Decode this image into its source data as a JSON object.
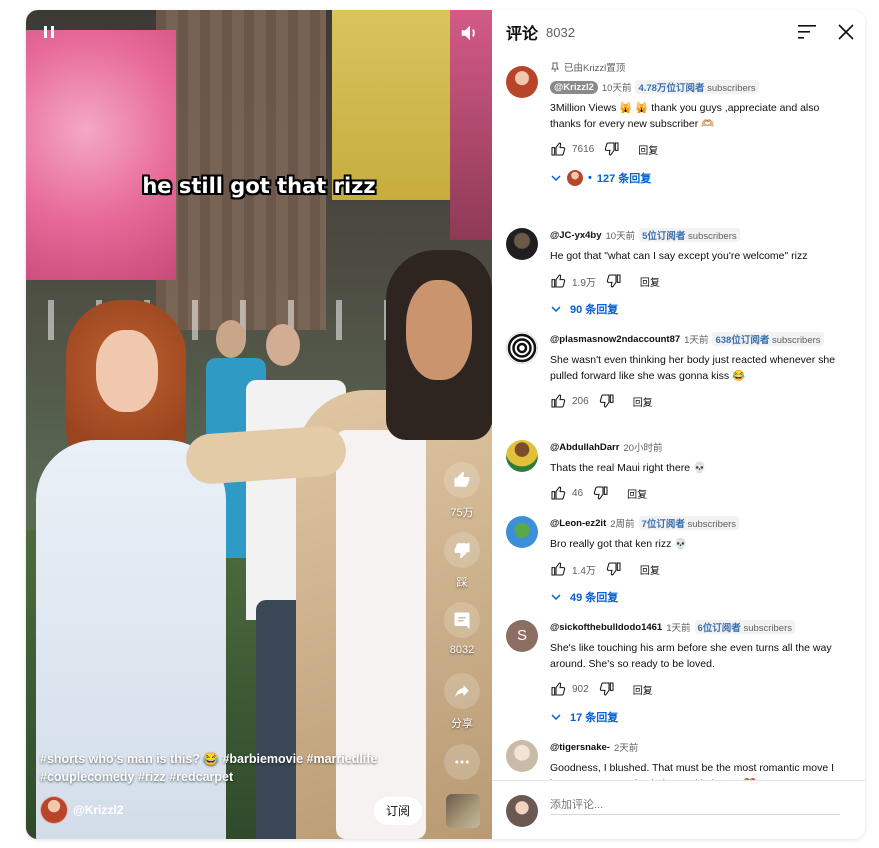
{
  "video": {
    "caption": "he still got that rizz",
    "hashtags": "#shorts who's man is this? 😂 #barbiemovie #marriedlife #couplecomedy #rizz #redcarpet",
    "channel_name": "@Krizzl2",
    "subscribe_label": "订阅",
    "like_count": "75万",
    "dislike_label": "踩",
    "comment_count": "8032",
    "share_label": "分享"
  },
  "comments_panel": {
    "title": "评论",
    "count": "8032",
    "add_placeholder": "添加评论...",
    "reply_label": "回复"
  },
  "comments": [
    {
      "pinned_label": "已由Krizzl置顶",
      "handle": "@Krizzl2",
      "owner": true,
      "time": "10天前",
      "subs_num": "4.78万位订阅者",
      "subs_suffix": "subscribers",
      "text": "3Million Views 🙀 🙀  thank you guys ,appreciate and also thanks for every new subscriber 🫶🏼",
      "likes": "7616",
      "replies": "127 条回复",
      "avatar_color": "#b8442a"
    },
    {
      "handle": "@JC-yx4by",
      "time": "10天前",
      "subs_num": "5位订阅者",
      "subs_suffix": "subscribers",
      "text": "He got that \"what can I say except you're welcome\" rizz",
      "likes": "1.9万",
      "replies": "90 条回复",
      "avatar_color": "#2b2b2b"
    },
    {
      "handle": "@plasmasnow2ndaccount87",
      "time": "1天前",
      "subs_num": "638位订阅者",
      "subs_suffix": "subscribers",
      "text": "She wasn't even thinking her body just reacted whenever she pulled forward like she was gonna kiss 😂",
      "likes": "206",
      "avatar_color": "#111111"
    },
    {
      "handle": "@AbdullahDarr",
      "time": "20小时前",
      "text": "Thats the real Maui right there 💀",
      "likes": "46",
      "avatar_color": "#e2c13a"
    },
    {
      "handle": "@Leon-ez2it",
      "time": "2周前",
      "subs_num": "7位订阅者",
      "subs_suffix": "subscribers",
      "text": "Bro really got that ken rizz 💀",
      "likes": "1.4万",
      "replies": "49 条回复",
      "avatar_color": "#3e8fd8"
    },
    {
      "handle": "@sickofthebulldodo1461",
      "time": "1天前",
      "subs_num": "6位订阅者",
      "subs_suffix": "subscribers",
      "text": "She's like touching his arm before she even turns all the way around. She's so ready to be loved.",
      "likes": "902",
      "replies": "17 条回复",
      "avatar_letter": "S",
      "avatar_color": "#8d6e63"
    },
    {
      "handle": "@tigersnake-",
      "time": "2天前",
      "text": "Goodness, I blushed. That must be the most romantic move I have ever seen. Simple but real intimate. ❤️",
      "avatar_color": "#d8cfc2"
    }
  ],
  "colors": {
    "accent_blue": "#065fd4",
    "subs_blue": "#3a6fb0",
    "muted_text": "#606060"
  }
}
